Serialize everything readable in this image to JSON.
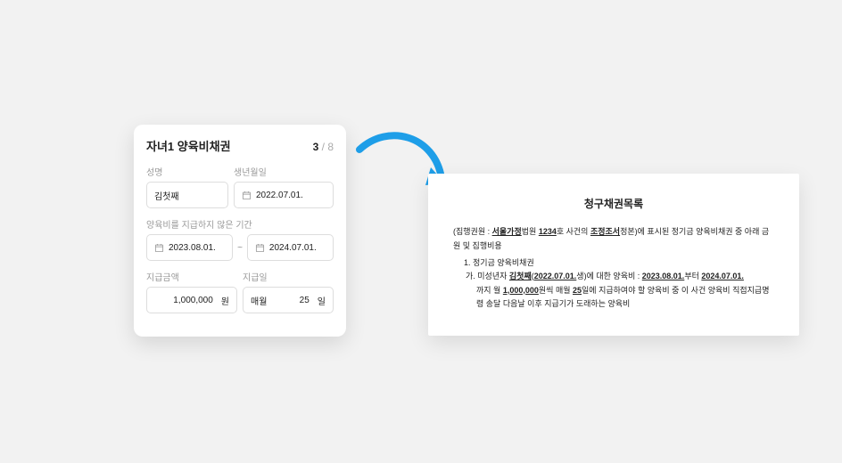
{
  "form": {
    "title": "자녀1 양육비채권",
    "step_current": "3",
    "step_total": " / 8",
    "labels": {
      "name": "성명",
      "dob": "생년월일",
      "unpaid_period": "양육비를 지급하지 않은 기간",
      "amount": "지급금액",
      "payday": "지급일"
    },
    "values": {
      "name": "김첫째",
      "dob": "2022.07.01.",
      "period_start": "2023.08.01.",
      "period_end": "2024.07.01.",
      "amount": "1,000,000",
      "amount_suffix": "원",
      "payday_prefix": "매월",
      "payday": "25",
      "payday_suffix": "일"
    },
    "tilde": "~"
  },
  "doc": {
    "title": "청구채권목록",
    "intro_prefix": "(집행권원 : ",
    "intro_b1": "서울가정",
    "intro_mid1": "법원 ",
    "intro_b2": "1234",
    "intro_mid2": "호 사건의 ",
    "intro_b3": "조정조서",
    "intro_suffix": "정본)에 표시된 정기금 양육비채권 중 아래 금원 및 집행비용",
    "item1": "1. 정기금 양육비채권",
    "item1a_prefix": "가. 미성년자 ",
    "item1a_name": "김첫째",
    "item1a_paren_open": "(",
    "item1a_dob": "2022.07.01.",
    "item1a_paren_close": "생)에 대한 양육비 : ",
    "item1a_start": "2023.08.01.",
    "item1a_mid": "부터 ",
    "item1a_end": "2024.07.01.",
    "item1a_cont1": "까지 월 ",
    "item1a_amount": "1,000,000",
    "item1a_cont2": "원씩 매월 ",
    "item1a_day": "25",
    "item1a_cont3": "일에 지급하여야 할 양육비 중 이 사건 양육비 직접지급명령 송달 다음날 이후 지급기가 도래하는 양육비"
  }
}
